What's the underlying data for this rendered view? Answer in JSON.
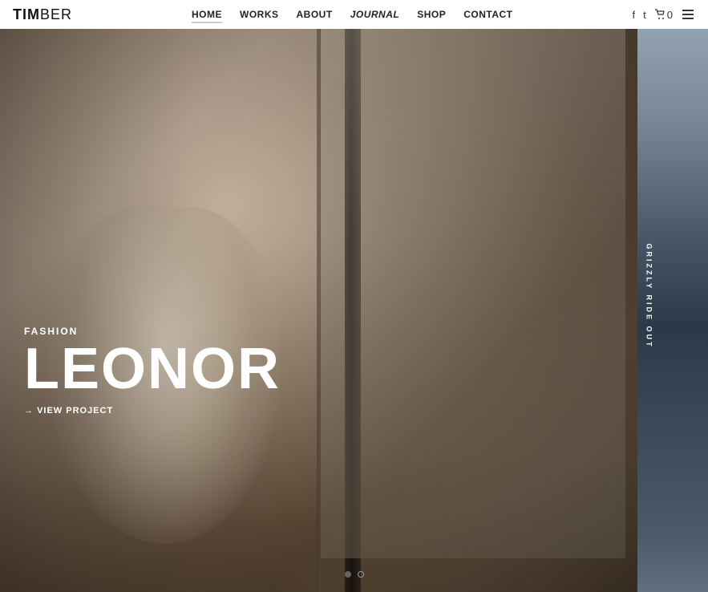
{
  "logo": {
    "text_bold": "TIM",
    "text_light": "BER"
  },
  "nav": {
    "items": [
      {
        "label": "HOME",
        "active": true
      },
      {
        "label": "WORKS",
        "active": false
      },
      {
        "label": "ABOUT",
        "active": false
      },
      {
        "label": "JOURNAL",
        "active": false
      },
      {
        "label": "SHOP",
        "active": false
      },
      {
        "label": "CONTACT",
        "active": false
      }
    ]
  },
  "header_right": {
    "facebook": "f",
    "twitter": "t",
    "cart_label": "0",
    "menu_icon": "≡"
  },
  "hero": {
    "slide": {
      "category": "FASHION",
      "title": "LEONOR",
      "link_text": "VIEW PROJECT"
    },
    "side_slide": {
      "text": "GRIZZLY RIDE OUT"
    },
    "dots": [
      {
        "active": true
      },
      {
        "active": false
      }
    ]
  }
}
